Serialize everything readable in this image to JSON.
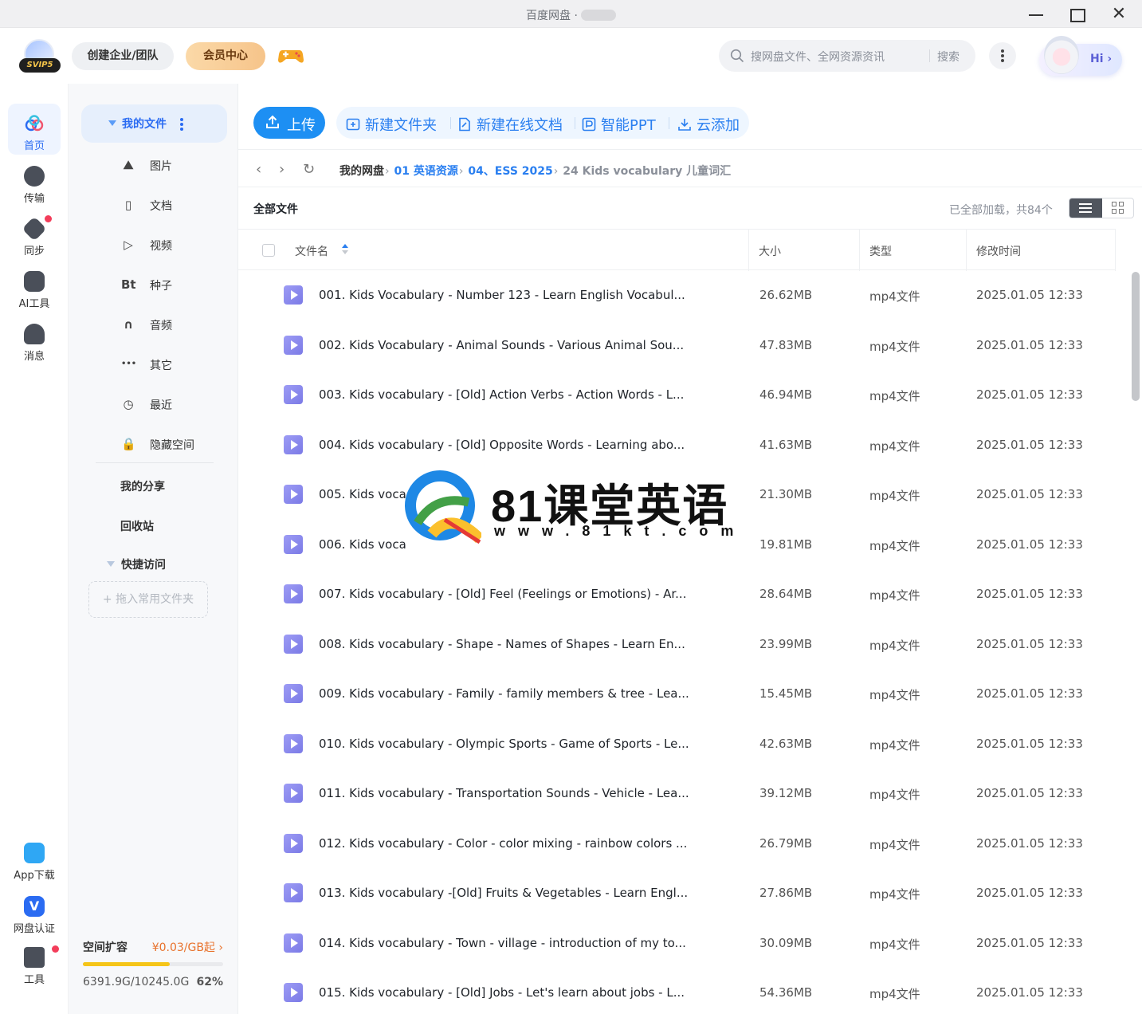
{
  "window": {
    "title": "百度网盘 ·"
  },
  "header": {
    "badge": "SVIP5",
    "team_label": "创建企业/团队",
    "vip_label": "会员中心",
    "search_placeholder": "搜网盘文件、全网资源资讯",
    "search_button": "搜索",
    "hi_label": "Hi ›"
  },
  "rail": {
    "items": [
      {
        "label": "首页"
      },
      {
        "label": "传输"
      },
      {
        "label": "同步"
      },
      {
        "label": "AI工具"
      },
      {
        "label": "消息"
      }
    ],
    "bottom": [
      {
        "label": "App下载"
      },
      {
        "label": "网盘认证"
      },
      {
        "label": "工具"
      }
    ]
  },
  "sidebar": {
    "my_files": "我的文件",
    "categories": [
      {
        "icon": "mountain-icon",
        "label": "图片"
      },
      {
        "icon": "document-icon",
        "label": "文档"
      },
      {
        "icon": "play-icon",
        "label": "视频"
      },
      {
        "icon": "torrent-icon",
        "icon_text": "Bt",
        "label": "种子"
      },
      {
        "icon": "headphones-icon",
        "label": "音频"
      },
      {
        "icon": "more-dots-icon",
        "icon_text": "•••",
        "label": "其它"
      },
      {
        "icon": "history-icon",
        "label": "最近"
      },
      {
        "icon": "lock-icon",
        "label": "隐藏空间"
      }
    ],
    "my_share": "我的分享",
    "recycle": "回收站",
    "quick_access": "快捷访问",
    "dropzone": "+ 拖入常用文件夹",
    "quota": {
      "title": "空间扩容",
      "price": "¥0.03/GB起 ›",
      "used_text": "6391.9G/10245.0G",
      "percent_text": "62%",
      "fraction": 0.62
    }
  },
  "toolbar": {
    "upload": "上传",
    "new_folder": "新建文件夹",
    "new_doc": "新建在线文档",
    "smart_ppt": "智能PPT",
    "cloud_add": "云添加"
  },
  "breadcrumb": {
    "root": "我的网盘",
    "level1": "01 英语资源",
    "level2": "04、ESS 2025",
    "current": "24 Kids vocabulary 儿童词汇"
  },
  "list": {
    "heading": "全部文件",
    "status": "已全部加载，共84个",
    "columns": {
      "name": "文件名",
      "size": "大小",
      "type": "类型",
      "modified": "修改时间"
    },
    "rows": [
      {
        "name": "001. Kids Vocabulary - Number 123 - Learn English Vocabul...",
        "size": "26.62MB",
        "type": "mp4文件",
        "modified": "2025.01.05 12:33"
      },
      {
        "name": "002. Kids Vocabulary - Animal Sounds - Various Animal Sou...",
        "size": "47.83MB",
        "type": "mp4文件",
        "modified": "2025.01.05 12:33"
      },
      {
        "name": "003. Kids vocabulary - [Old] Action Verbs - Action Words - L...",
        "size": "46.94MB",
        "type": "mp4文件",
        "modified": "2025.01.05 12:33"
      },
      {
        "name": "004. Kids vocabulary - [Old] Opposite Words - Learning abo...",
        "size": "41.63MB",
        "type": "mp4文件",
        "modified": "2025.01.05 12:33"
      },
      {
        "name": "005. Kids voca",
        "size": "21.30MB",
        "type": "mp4文件",
        "modified": "2025.01.05 12:33"
      },
      {
        "name": "006. Kids voca",
        "size": "19.81MB",
        "type": "mp4文件",
        "modified": "2025.01.05 12:33"
      },
      {
        "name": "007. Kids vocabulary - [Old] Feel (Feelings or Emotions) - Ar...",
        "size": "28.64MB",
        "type": "mp4文件",
        "modified": "2025.01.05 12:33"
      },
      {
        "name": "008. Kids vocabulary - Shape - Names of Shapes - Learn En...",
        "size": "23.99MB",
        "type": "mp4文件",
        "modified": "2025.01.05 12:33"
      },
      {
        "name": "009. Kids vocabulary - Family - family members & tree - Lea...",
        "size": "15.45MB",
        "type": "mp4文件",
        "modified": "2025.01.05 12:33"
      },
      {
        "name": "010. Kids vocabulary - Olympic Sports - Game of Sports - Le...",
        "size": "42.63MB",
        "type": "mp4文件",
        "modified": "2025.01.05 12:33"
      },
      {
        "name": "011. Kids vocabulary - Transportation Sounds - Vehicle - Lea...",
        "size": "39.12MB",
        "type": "mp4文件",
        "modified": "2025.01.05 12:33"
      },
      {
        "name": "012. Kids vocabulary - Color - color mixing - rainbow colors ...",
        "size": "26.79MB",
        "type": "mp4文件",
        "modified": "2025.01.05 12:33"
      },
      {
        "name": "013. Kids vocabulary -[Old] Fruits & Vegetables - Learn Engl...",
        "size": "27.86MB",
        "type": "mp4文件",
        "modified": "2025.01.05 12:33"
      },
      {
        "name": "014. Kids vocabulary - Town - village - introduction of my to...",
        "size": "30.09MB",
        "type": "mp4文件",
        "modified": "2025.01.05 12:33"
      },
      {
        "name": "015. Kids vocabulary - [Old] Jobs - Let's learn about jobs - L...",
        "size": "54.36MB",
        "type": "mp4文件",
        "modified": "2025.01.05 12:33"
      }
    ]
  },
  "watermark": {
    "title": "81课堂英语",
    "url": "www.81kt.com"
  },
  "colors": {
    "accent": "#2a7ff0",
    "upload": "#1d8ff3",
    "vip": "#f6c48a",
    "quota_fill": "#f5c518",
    "notification": "#f33d5a",
    "video_icon": "#8a89ee"
  }
}
